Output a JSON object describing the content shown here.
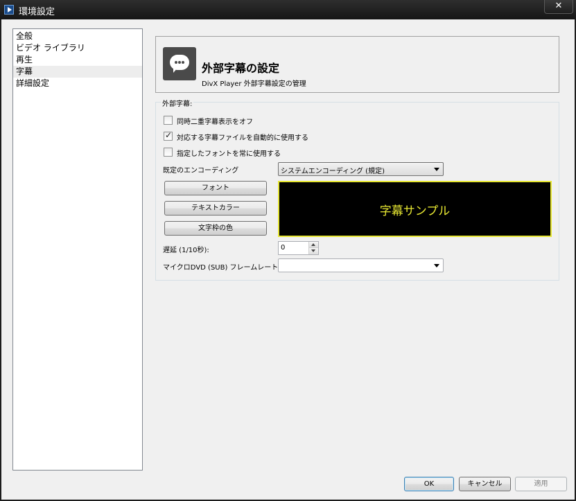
{
  "window": {
    "title": "環境設定",
    "close_label": "✕"
  },
  "nav": {
    "items": [
      {
        "label": "全般"
      },
      {
        "label": "ビデオ ライブラリ"
      },
      {
        "label": "再生"
      },
      {
        "label": "字幕"
      },
      {
        "label": "詳細設定"
      }
    ]
  },
  "header": {
    "title": "外部字幕の設定",
    "subtitle": "DivX Player 外部字幕設定の管理"
  },
  "group": {
    "label": "外部字幕:",
    "checkboxes": [
      {
        "label": "同時二重字幕表示をオフ",
        "checked": false
      },
      {
        "label": "対応する字幕ファイルを自動的に使用する",
        "checked": true
      },
      {
        "label": "指定したフォントを常に使用する",
        "checked": false
      }
    ],
    "encoding_label": "既定のエンコーディング",
    "encoding_value": "システムエンコーディング (規定)",
    "font_button": "フォント",
    "text_color_button": "テキストカラー",
    "outline_color_button": "文字枠の色",
    "preview_text": "字幕サンプル",
    "delay_label": "遅延 (1/10秒):",
    "delay_value": "0",
    "framerate_label": "マイクロDVD (SUB) フレームレート:",
    "framerate_value": ""
  },
  "footer": {
    "ok": "OK",
    "cancel": "キャンセル",
    "apply": "適用"
  },
  "colors": {
    "preview_bg": "#000000",
    "preview_text": "#e6e632",
    "title_bar": "#1c1c1c"
  }
}
